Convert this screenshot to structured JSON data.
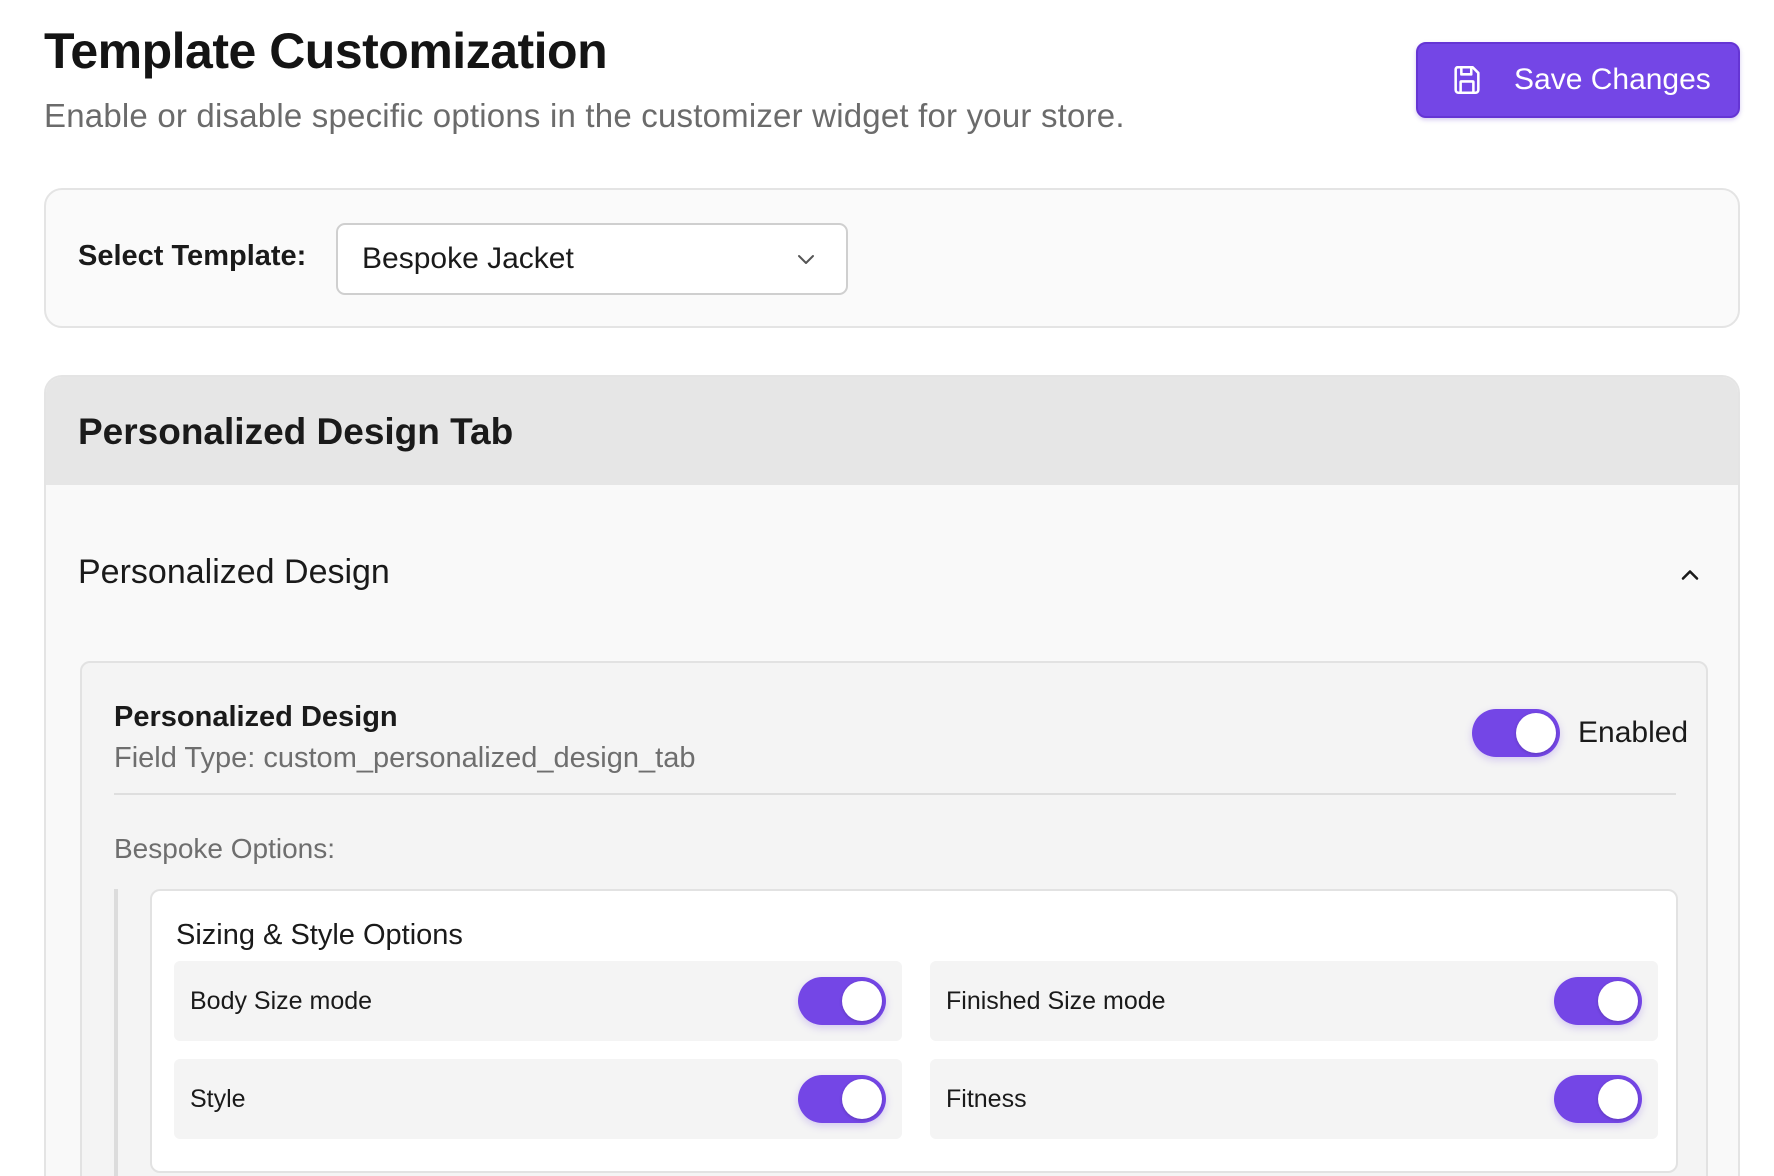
{
  "header": {
    "title": "Template Customization",
    "subtitle": "Enable or disable specific options in the customizer widget for your store.",
    "save_label": "Save Changes",
    "save_icon": "save-icon"
  },
  "template_select": {
    "label": "Select Template:",
    "value": "Bespoke Jacket",
    "icon": "chevron-down-icon"
  },
  "section": {
    "title": "Personalized Design Tab",
    "accordion": {
      "title": "Personalized Design",
      "expanded": true,
      "toggle_icon": "chevron-up-icon"
    },
    "field": {
      "name": "Personalized Design",
      "type_text": "Field Type: custom_personalized_design_tab",
      "enabled": true,
      "status_label": "Enabled",
      "options_label": "Bespoke Options:",
      "group": {
        "title": "Sizing & Style Options",
        "options": [
          {
            "label": "Body Size mode",
            "enabled": true
          },
          {
            "label": "Finished Size mode",
            "enabled": true
          },
          {
            "label": "Style",
            "enabled": true
          },
          {
            "label": "Fitness",
            "enabled": true
          }
        ]
      }
    }
  },
  "colors": {
    "accent": "#7446e6",
    "page_bg": "#ffffff",
    "section_header_bg": "#e6e6e6"
  }
}
